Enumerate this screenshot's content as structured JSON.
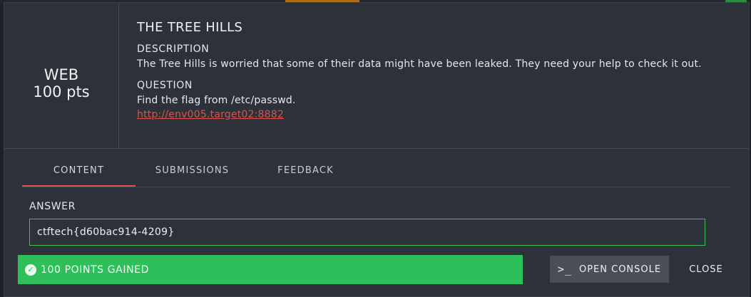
{
  "challenge": {
    "category": "WEB",
    "points": "100 pts",
    "title": "THE TREE HILLS",
    "description_label": "DESCRIPTION",
    "description": "The Tree Hills is worried that some of their data might have been leaked. They need your help to check it out.",
    "question_label": "QUESTION",
    "question": "Find the flag from /etc/passwd.",
    "link": "http://env005.target02:8882"
  },
  "tabs": [
    {
      "label": "CONTENT",
      "active": true
    },
    {
      "label": "SUBMISSIONS",
      "active": false
    },
    {
      "label": "FEEDBACK",
      "active": false
    }
  ],
  "answer": {
    "label": "ANSWER",
    "value": "ctftech{d60bac914-4209}"
  },
  "status": {
    "message": "100 POINTS GAINED"
  },
  "buttons": {
    "open_console": "OPEN CONSOLE",
    "close": "CLOSE"
  },
  "colors": {
    "accent": "#d9534f",
    "success": "#2fbf5a",
    "input_border": "#3fbf55"
  }
}
